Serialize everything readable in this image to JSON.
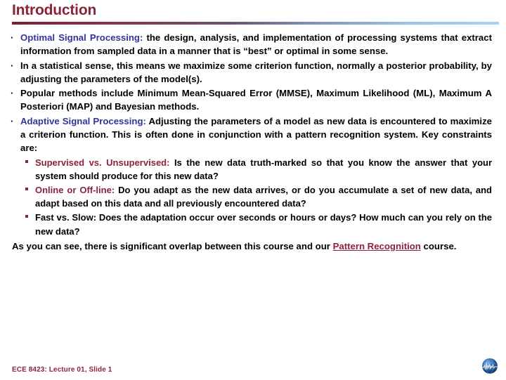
{
  "slide": {
    "title": "Introduction",
    "bullet_marker": "·",
    "colors": {
      "title": "#8c2338",
      "accent_maroon": "#8c2338",
      "lead_navy": "#333399",
      "body": "#000000",
      "rule_start": "#7d1f33",
      "rule_end": "#a9d2f5"
    },
    "bullets": [
      {
        "lead": "Optimal Signal Processing:",
        "lead_style": "navy",
        "text": " the design, analysis, and implementation of processing systems that extract information from sampled data in a manner that is “best” or optimal in some sense."
      },
      {
        "lead": "",
        "lead_style": "none",
        "text": "In a statistical sense, this means we maximize some criterion function, normally a posterior probability, by adjusting the parameters of the model(s)."
      },
      {
        "lead": "",
        "lead_style": "none",
        "text": "Popular methods include Minimum Mean-Squared Error (MMSE), Maximum Likelihood (ML), Maximum A Posteriori (MAP) and Bayesian methods."
      },
      {
        "lead": "Adaptive Signal Processing:",
        "lead_style": "navy",
        "text": " Adjusting the parameters of a model as new data is encountered to maximize a criterion function. This is often done in conjunction with a pattern recognition system. Key constraints are:"
      }
    ],
    "subbullets": [
      {
        "lead": "Supervised vs. Unsupervised:",
        "lead_style": "maroon",
        "text": " Is the new data truth-marked so that you know the answer that your system should produce for this new data?"
      },
      {
        "lead": "Online or Off-line:",
        "lead_style": "maroon",
        "text": " Do you adapt as the new data arrives, or do you accumulate a set of new data, and adapt based on this data and all previously encountered data?"
      },
      {
        "lead": "",
        "lead_style": "none",
        "text": "Fast vs. Slow: Does the adaptation occur over seconds or hours or days? How much can you rely on the new data?"
      }
    ],
    "closing": {
      "before_link": "As you can see, there is significant overlap between this course and our ",
      "link_text": "Pattern Recognition",
      "after_link": " course."
    },
    "footer": "ECE 8423: Lecture 01, Slide 1",
    "logo_name": "globe-waveform-logo"
  }
}
